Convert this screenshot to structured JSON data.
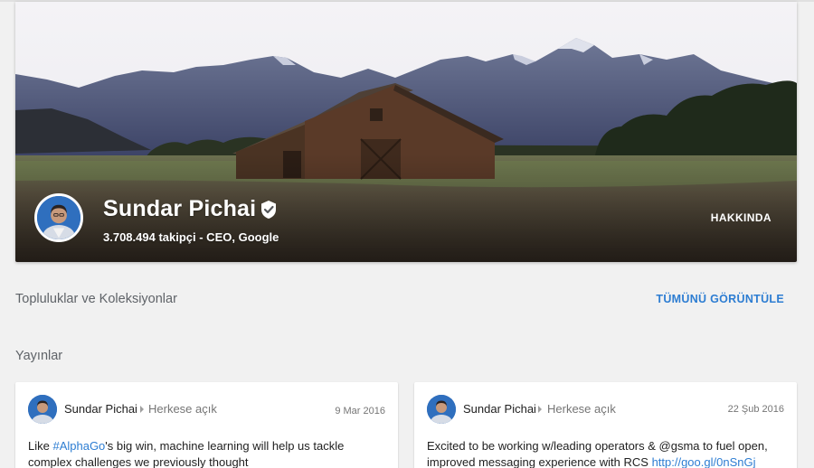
{
  "profile": {
    "name": "Sundar Pichai",
    "subtitle": "3.708.494 takipçi - CEO, Google",
    "about_label": "HAKKINDA"
  },
  "communities": {
    "title": "Topluluklar ve Koleksiyonlar",
    "view_all_label": "TÜMÜNÜ GÖRÜNTÜLE"
  },
  "posts_section": {
    "title": "Yayınlar"
  },
  "posts": [
    {
      "author": "Sundar Pichai",
      "audience": "Herkese açık",
      "date": "9 Mar 2016",
      "text_before": "Like ",
      "link": "#AlphaGo",
      "text_after": "'s big win, machine learning will help us tackle complex challenges we previously thought"
    },
    {
      "author": "Sundar Pichai",
      "audience": "Herkese açık",
      "date": "22 Şub 2016",
      "text_before": "Excited to be working w/leading operators & @gsma to fuel open, improved messaging experience with RCS ",
      "link": "http://goo.gl/0nSnGj",
      "text_after": ""
    }
  ],
  "icons": {
    "verified": "verified-badge-icon",
    "audience_separator": "chevron-right-icon"
  },
  "colors": {
    "accent_link": "#2d7dd2",
    "page_background": "#f1f1f1"
  }
}
